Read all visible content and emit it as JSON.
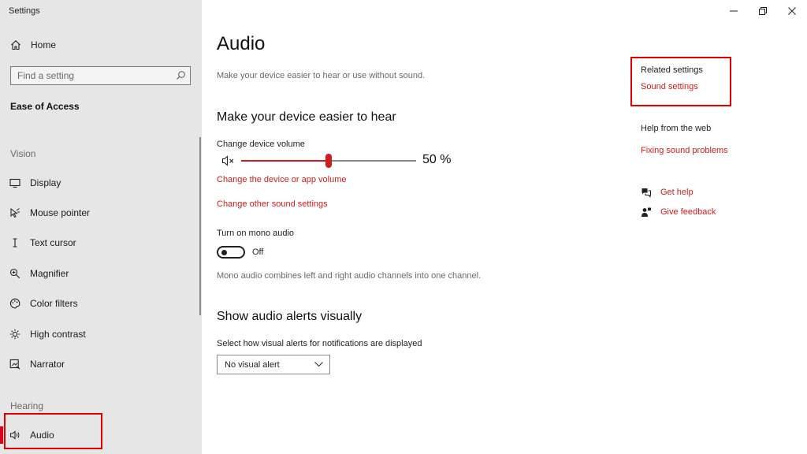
{
  "app": {
    "title": "Settings"
  },
  "sidebar": {
    "home": "Home",
    "search_placeholder": "Find a setting",
    "section_title": "Ease of Access",
    "groups": {
      "vision": "Vision",
      "hearing": "Hearing"
    },
    "items": [
      {
        "label": "Display",
        "icon": "display-icon"
      },
      {
        "label": "Mouse pointer",
        "icon": "mouse-pointer-icon"
      },
      {
        "label": "Text cursor",
        "icon": "text-cursor-icon"
      },
      {
        "label": "Magnifier",
        "icon": "magnifier-icon"
      },
      {
        "label": "Color filters",
        "icon": "color-filters-icon"
      },
      {
        "label": "High contrast",
        "icon": "high-contrast-icon"
      },
      {
        "label": "Narrator",
        "icon": "narrator-icon"
      },
      {
        "label": "Audio",
        "icon": "audio-icon",
        "active": true
      }
    ]
  },
  "main": {
    "title": "Audio",
    "subtitle": "Make your device easier to hear or use without sound.",
    "hear_section": {
      "heading": "Make your device easier to hear",
      "volume_label": "Change device volume",
      "volume_value": 50,
      "volume_display": "50 %",
      "link_app_volume": "Change the device or app volume",
      "link_other_sound": "Change other sound settings",
      "mono_label": "Turn on mono audio",
      "mono_state": "Off",
      "mono_desc": "Mono audio combines left and right audio channels into one channel."
    },
    "alerts_section": {
      "heading": "Show audio alerts visually",
      "select_label": "Select how visual alerts for notifications are displayed",
      "select_value": "No visual alert"
    }
  },
  "right": {
    "related_heading": "Related settings",
    "sound_settings": "Sound settings",
    "help_heading": "Help from the web",
    "fixing_sound": "Fixing sound problems",
    "get_help": "Get help",
    "give_feedback": "Give feedback"
  },
  "colors": {
    "accent": "#d01c1c",
    "highlight_box": "#e00000",
    "sidebar_bg": "#e6e6e6"
  }
}
